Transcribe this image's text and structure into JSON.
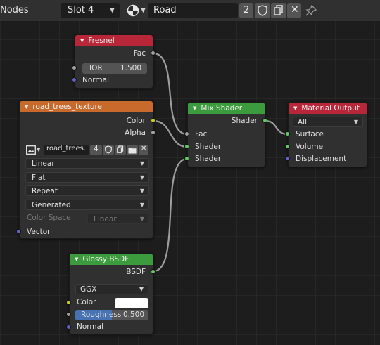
{
  "header": {
    "editor_label": "Nodes",
    "slot": "Slot 4",
    "material_name": "Road",
    "user_count": "2"
  },
  "nodes": {
    "fresnel": {
      "title": "Fresnel",
      "out_fac": "Fac",
      "ior_label": "IOR",
      "ior_value": "1.500",
      "normal": "Normal"
    },
    "image_texture": {
      "title": "road_trees_texture",
      "out_color": "Color",
      "out_alpha": "Alpha",
      "image_name": "road_trees...",
      "image_users": "4",
      "interpolation": "Linear",
      "projection": "Flat",
      "extension": "Repeat",
      "source": "Generated",
      "color_space_label": "Color Space",
      "color_space_value": "Linear",
      "vector": "Vector"
    },
    "mix_shader": {
      "title": "Mix Shader",
      "out_shader": "Shader",
      "fac": "Fac",
      "shader1": "Shader",
      "shader2": "Shader"
    },
    "material_output": {
      "title": "Material Output",
      "target": "All",
      "surface": "Surface",
      "volume": "Volume",
      "displacement": "Displacement"
    },
    "glossy": {
      "title": "Glossy BSDF",
      "out_bsdf": "BSDF",
      "distribution": "GGX",
      "color_label": "Color",
      "roughness_label": "Roughness",
      "roughness_value": "0.500",
      "roughness_fraction": 0.5,
      "normal": "Normal"
    }
  },
  "colors": {
    "header_texture": "#c86a2c",
    "header_shader": "#3c9b3c",
    "header_input": "#b8263a",
    "header_output": "#b8263a",
    "socket_shader": "#63c763",
    "socket_color": "#c7c729",
    "socket_vector": "#6363c7",
    "socket_float": "#a1a1a1",
    "roughness_fill": "#4772b3"
  }
}
